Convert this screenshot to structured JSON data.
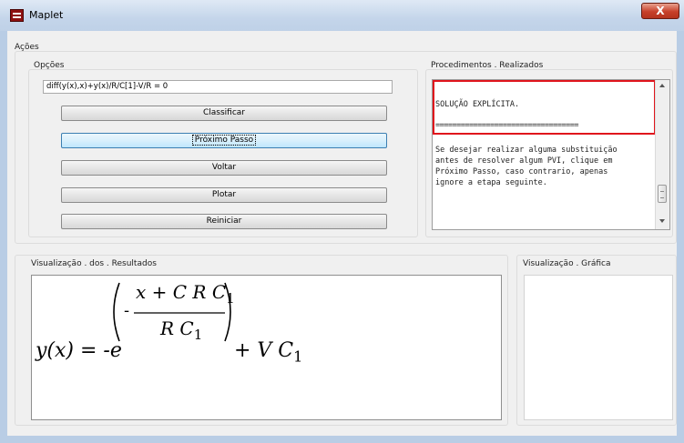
{
  "window": {
    "title": "Maplet",
    "close_glyph": "X"
  },
  "sections": {
    "acoes": "Ações",
    "opcoes": "Opções",
    "procedimentos": "Procedimentos . Realizados",
    "visualizacao_resultados": "Visualização . dos . Resultados",
    "visualizacao_grafica": "Visualização . Gráfica"
  },
  "equation_input": {
    "value": "diff(y(x),x)+y(x)/R/C[1]-V/R = 0"
  },
  "buttons": {
    "classificar": "Classificar",
    "proximo_passo": "Próximo Passo",
    "voltar": "Voltar",
    "plotar": "Plotar",
    "reiniciar": "Reiniciar"
  },
  "procedures": {
    "line1": "SOLUÇÃO EXPLÍCITA.",
    "separator": "==================================",
    "paragraph": "Se desejar realizar alguma substituição\nantes de resolver algum PVI, clique em\nPróximo Passo, caso contrario, apenas\nignore a etapa seguinte."
  },
  "result_math": {
    "lhs": "y(x) = -e",
    "minus": "-",
    "numerator": "x + C R C",
    "sub_num": "1",
    "denominator": "R C",
    "sub_den": "1",
    "tail": "+ V C",
    "sub_tail": "1"
  },
  "colors": {
    "title_bar": "#c4d5ea",
    "close_button": "#c7402a",
    "highlight": "#e0141c",
    "focused_button": "#bee6fd"
  },
  "icons": [
    "maple-app-icon",
    "close-icon",
    "scroll-up-icon",
    "scroll-down-icon"
  ]
}
